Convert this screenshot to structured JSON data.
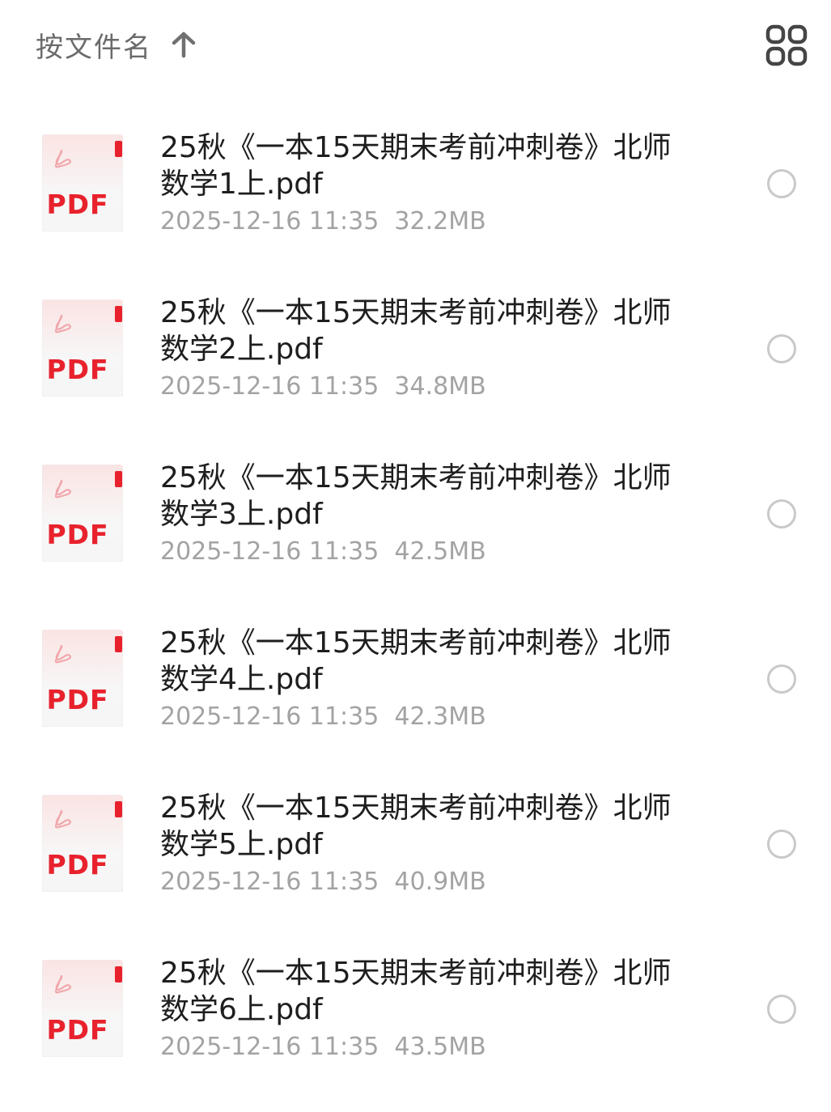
{
  "toolbar": {
    "sort_label": "按文件名",
    "sort_icon": "arrow-up-icon",
    "view_icon": "grid-view-icon"
  },
  "file_icon": {
    "label": "PDF",
    "icon": "pdf-file-icon",
    "accent": "#e8222d"
  },
  "files": [
    {
      "name": "25秋《一本15天期末考前冲刺卷》北师数学1上.pdf",
      "date": "2025-12-16 11:35",
      "size": "32.2MB"
    },
    {
      "name": "25秋《一本15天期末考前冲刺卷》北师数学2上.pdf",
      "date": "2025-12-16 11:35",
      "size": "34.8MB"
    },
    {
      "name": "25秋《一本15天期末考前冲刺卷》北师数学3上.pdf",
      "date": "2025-12-16 11:35",
      "size": "42.5MB"
    },
    {
      "name": "25秋《一本15天期末考前冲刺卷》北师数学4上.pdf",
      "date": "2025-12-16 11:35",
      "size": "42.3MB"
    },
    {
      "name": "25秋《一本15天期末考前冲刺卷》北师数学5上.pdf",
      "date": "2025-12-16 11:35",
      "size": "40.9MB"
    },
    {
      "name": "25秋《一本15天期末考前冲刺卷》北师数学6上.pdf",
      "date": "2025-12-16 11:35",
      "size": "43.5MB"
    }
  ]
}
